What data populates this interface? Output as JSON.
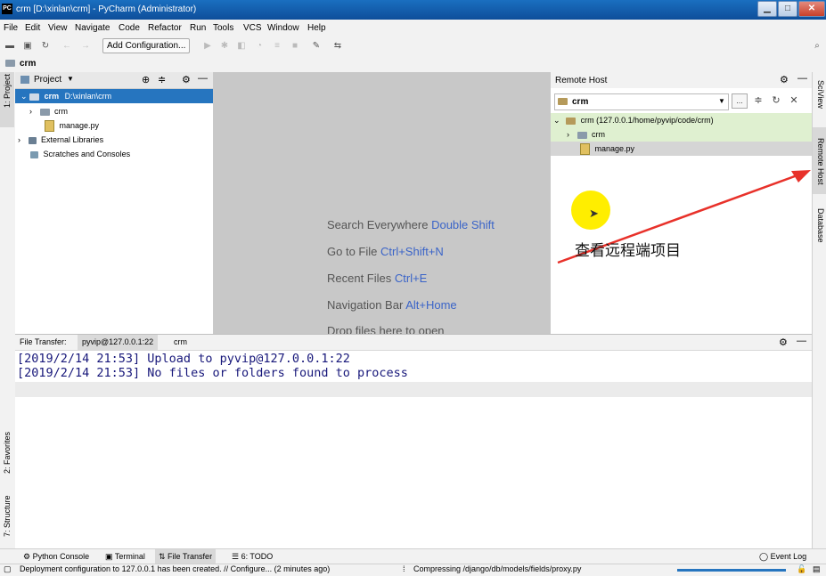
{
  "window": {
    "title": "crm [D:\\xinlan\\crm] - PyCharm (Administrator)",
    "logo": "PC",
    "controls": [
      "minimize-icon",
      "maximize-icon",
      "close-icon"
    ]
  },
  "menu": {
    "items": [
      "File",
      "Edit",
      "View",
      "Navigate",
      "Code",
      "Refactor",
      "Run",
      "Tools",
      "VCS",
      "Window",
      "Help"
    ]
  },
  "toolbar": {
    "add_configuration": "Add Configuration..."
  },
  "navbar": {
    "crumb": "crm"
  },
  "left_stripe": {
    "project_tab": "1: Project",
    "favorites_tab": "2: Favorites",
    "structure_tab": "7: Structure"
  },
  "project": {
    "header_label": "Project",
    "tree": [
      {
        "name": "crm",
        "path": "D:\\xinlan\\crm",
        "icon": "folder-icon"
      },
      {
        "name": "crm",
        "icon": "folder-icon"
      },
      {
        "name": "manage.py",
        "icon": "python-file-icon"
      },
      {
        "name": "External Libraries",
        "icon": "library-icon"
      },
      {
        "name": "Scratches and Consoles",
        "icon": "scratch-icon"
      }
    ]
  },
  "editor": {
    "hints": [
      {
        "text": "Search Everywhere",
        "key": "Double Shift"
      },
      {
        "text": "Go to File",
        "key": "Ctrl+Shift+N"
      },
      {
        "text": "Recent Files",
        "key": "Ctrl+E"
      },
      {
        "text": "Navigation Bar",
        "key": "Alt+Home"
      },
      {
        "text": "Drop files here to open",
        "key": ""
      }
    ]
  },
  "remote_host": {
    "header": "Remote Host",
    "server": "crm",
    "tree": [
      {
        "name": "crm (127.0.0.1/home/pyvip/code/crm)"
      },
      {
        "name": "crm"
      },
      {
        "name": "manage.py"
      }
    ],
    "more_button": "...",
    "highlight_color": "#dff0d0"
  },
  "right_stripe": {
    "tabs": [
      "SciView",
      "Remote Host",
      "Database"
    ]
  },
  "file_transfer": {
    "label": "File Transfer:",
    "tabs": [
      "pyvip@127.0.0.1:22",
      "crm"
    ],
    "log": [
      "[2019/2/14 21:53] Upload to pyvip@127.0.0.1:22",
      "[2019/2/14 21:53] No files or folders found to process"
    ]
  },
  "bottom_tabs": {
    "python_console": "Python Console",
    "terminal": "Terminal",
    "file_transfer": "File Transfer",
    "todo": "6: TODO",
    "event_log": "Event Log"
  },
  "status": {
    "message": "Deployment configuration to 127.0.0.1 has been created. // Configure... (2 minutes ago)",
    "progress_text": "Compressing /django/db/models/fields/proxy.py"
  },
  "annotation": {
    "text": "查看远程端项目",
    "arrow_color": "#e8312a",
    "cursor_highlight": "#ffee00"
  }
}
